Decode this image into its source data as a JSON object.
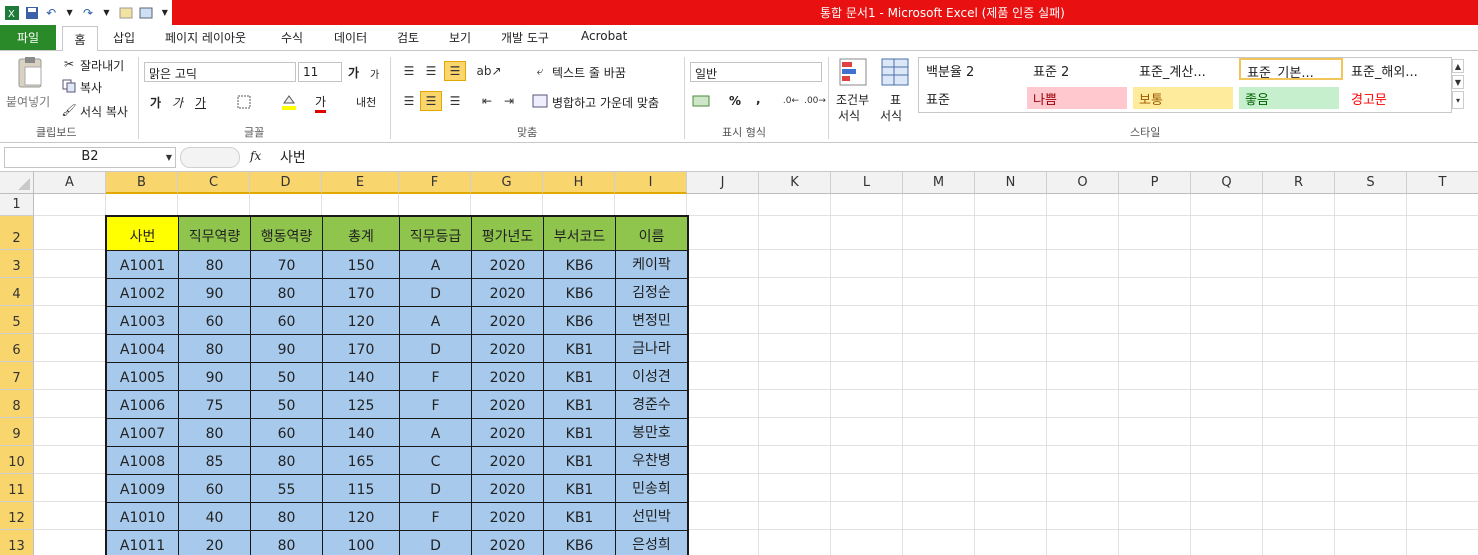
{
  "window": {
    "title": "통합 문서1  -  Microsoft Excel (제품 인증 실패)"
  },
  "ribbon_tabs": [
    "파일",
    "홈",
    "삽입",
    "페이지 레이아웃",
    "수식",
    "데이터",
    "검토",
    "보기",
    "개발 도구",
    "Acrobat"
  ],
  "clipboard": {
    "paste": "붙여넣기",
    "cut": "잘라내기",
    "copy": "복사",
    "format_painter": "서식 복사",
    "label": "클립보드"
  },
  "font": {
    "name": "맑은 고딕",
    "size": "11",
    "grow": "가",
    "shrink": "가",
    "bold": "가",
    "italic": "가",
    "underline": "가",
    "color_letter": "가",
    "phonetic": "내천",
    "label": "글꼴"
  },
  "alignment": {
    "wrap_text": "텍스트 줄 바꿈",
    "merge_center": "병합하고 가운데 맞춤",
    "label": "맞춤"
  },
  "number": {
    "format": "일반",
    "percent": "%",
    "comma": ",",
    "label": "표시 형식"
  },
  "styles_group": {
    "conditional_line1": "조건부",
    "conditional_line2": "서식",
    "table_line1": "표",
    "table_line2": "서식",
    "label": "스타일",
    "cells": [
      {
        "text": "백분율 2",
        "bg": "#ffffff",
        "fg": "#222222"
      },
      {
        "text": "표준 2",
        "bg": "#ffffff",
        "fg": "#222222"
      },
      {
        "text": "표준_계산...",
        "bg": "#ffffff",
        "fg": "#222222"
      },
      {
        "text": "표준_기본...",
        "bg": "#ffffff",
        "fg": "#222222"
      },
      {
        "text": "표준_해외...",
        "bg": "#ffffff",
        "fg": "#222222"
      },
      {
        "text": "표준",
        "bg": "#ffffff",
        "fg": "#222222"
      },
      {
        "text": "나쁨",
        "bg": "#ffc7ce",
        "fg": "#9c0006"
      },
      {
        "text": "보통",
        "bg": "#ffeb9c",
        "fg": "#9c5700"
      },
      {
        "text": "좋음",
        "bg": "#c6efce",
        "fg": "#006100"
      },
      {
        "text": "경고문",
        "bg": "#ffffff",
        "fg": "#ff0000"
      }
    ]
  },
  "formula_bar": {
    "name_box": "B2",
    "fx": "fx",
    "content": "사번"
  },
  "columns": [
    "A",
    "B",
    "C",
    "D",
    "E",
    "F",
    "G",
    "H",
    "I",
    "J",
    "K",
    "L",
    "M",
    "N",
    "O",
    "P",
    "Q",
    "R",
    "S",
    "T"
  ],
  "rows": [
    "1",
    "2",
    "3",
    "4",
    "5",
    "6",
    "7",
    "8",
    "9",
    "10",
    "11",
    "12",
    "13"
  ],
  "table": {
    "headers": [
      "사번",
      "직무역량",
      "행동역량",
      "총계",
      "직무등급",
      "평가년도",
      "부서코드",
      "이름"
    ],
    "rows": [
      [
        "A1001",
        "80",
        "70",
        "150",
        "A",
        "2020",
        "KB6",
        "케이팍"
      ],
      [
        "A1002",
        "90",
        "80",
        "170",
        "D",
        "2020",
        "KB6",
        "김정순"
      ],
      [
        "A1003",
        "60",
        "60",
        "120",
        "A",
        "2020",
        "KB6",
        "변정민"
      ],
      [
        "A1004",
        "80",
        "90",
        "170",
        "D",
        "2020",
        "KB1",
        "금나라"
      ],
      [
        "A1005",
        "90",
        "50",
        "140",
        "F",
        "2020",
        "KB1",
        "이성견"
      ],
      [
        "A1006",
        "75",
        "50",
        "125",
        "F",
        "2020",
        "KB1",
        "경준수"
      ],
      [
        "A1007",
        "80",
        "60",
        "140",
        "A",
        "2020",
        "KB1",
        "봉만호"
      ],
      [
        "A1008",
        "85",
        "80",
        "165",
        "C",
        "2020",
        "KB1",
        "우찬병"
      ],
      [
        "A1009",
        "60",
        "55",
        "115",
        "D",
        "2020",
        "KB1",
        "민송희"
      ],
      [
        "A1010",
        "40",
        "80",
        "120",
        "F",
        "2020",
        "KB1",
        "선민박"
      ],
      [
        "A1011",
        "20",
        "80",
        "100",
        "D",
        "2020",
        "KB6",
        "은성희"
      ]
    ]
  },
  "colors": {
    "title_bar": "#e81010",
    "file_tab": "#2a8a2a",
    "header_first": "#ffff00",
    "header_rest": "#8fc44d",
    "data_fill": "#a6c9ec",
    "selected_header": "#f9d56e"
  }
}
